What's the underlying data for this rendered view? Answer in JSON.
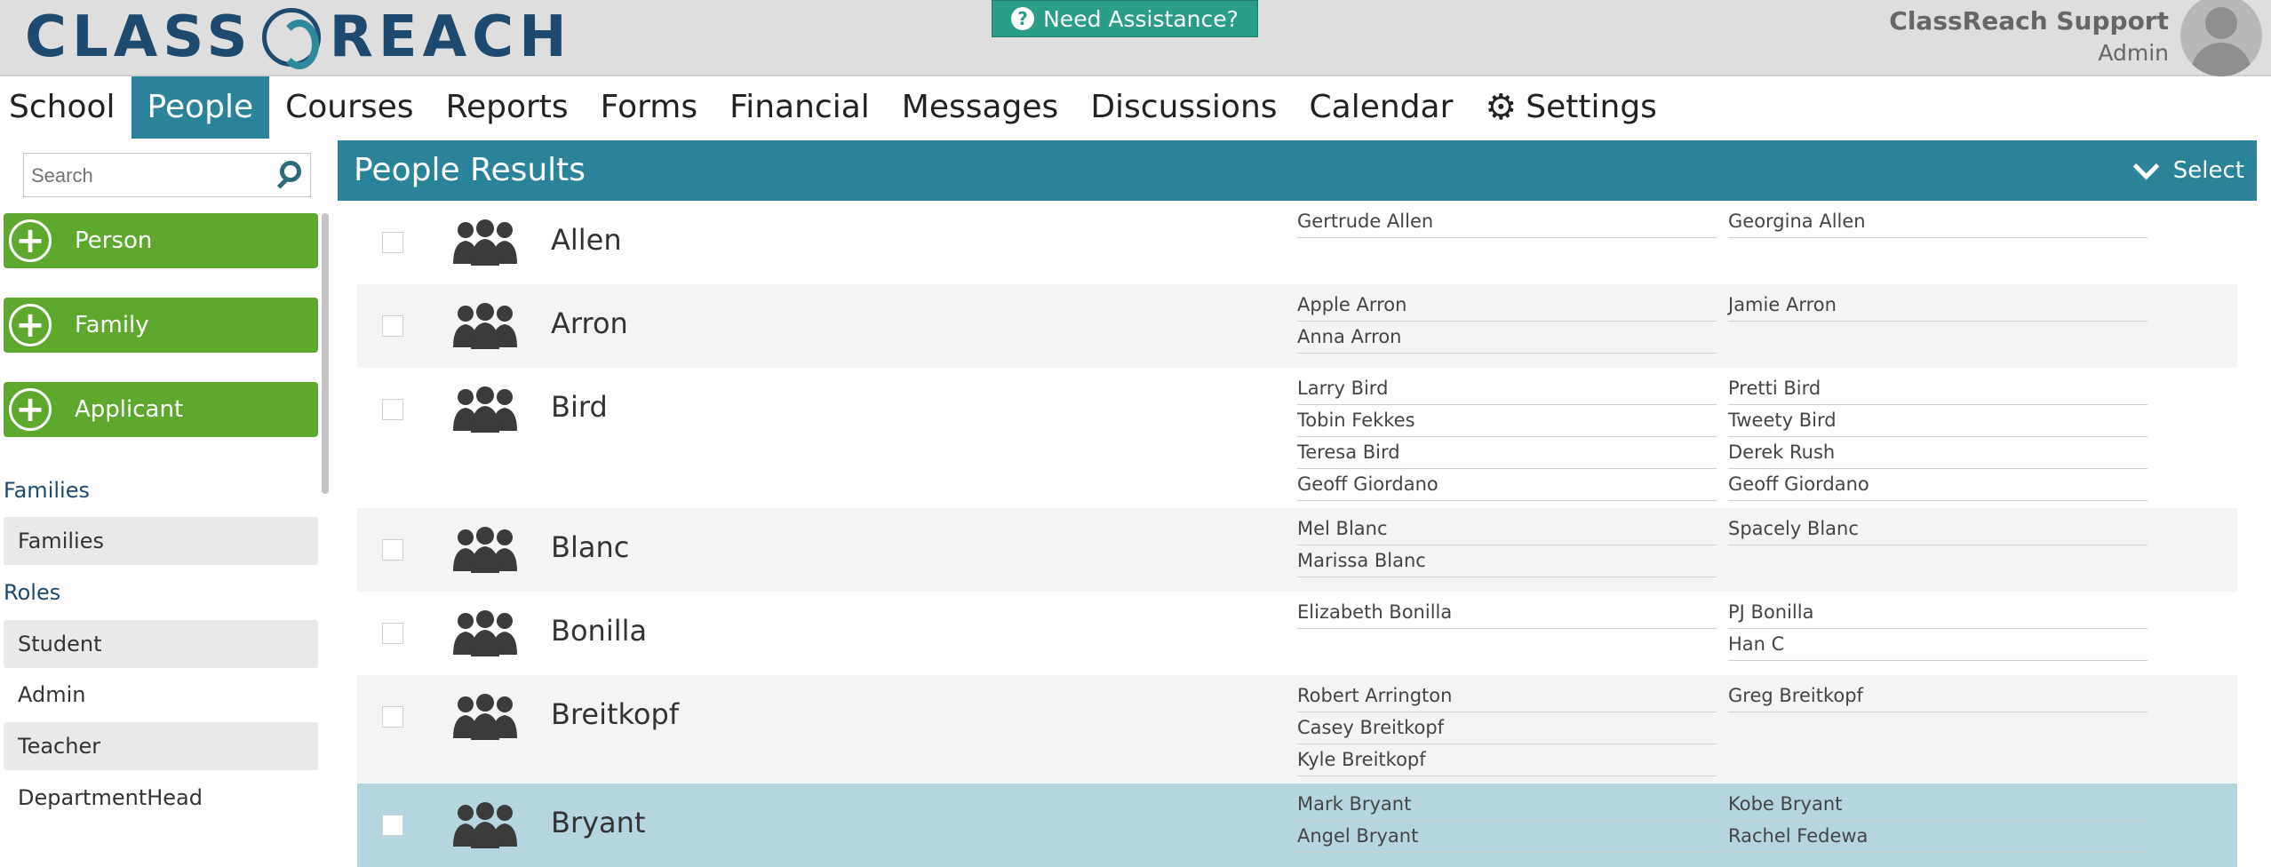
{
  "header": {
    "logo_text_left": "CLASS",
    "logo_text_right": "REACH",
    "help_label": "Need Assistance?",
    "user_name": "ClassReach Support",
    "user_role": "Admin"
  },
  "nav": {
    "items": [
      "School",
      "People",
      "Courses",
      "Reports",
      "Forms",
      "Financial",
      "Messages",
      "Discussions",
      "Calendar",
      "Settings"
    ],
    "active": "People"
  },
  "sidebar": {
    "search_placeholder": "Search",
    "add_buttons": [
      "Person",
      "Family",
      "Applicant"
    ],
    "families_heading": "Families",
    "families_links": [
      "Families"
    ],
    "roles_heading": "Roles",
    "roles_links": [
      "Student",
      "Admin",
      "Teacher",
      "DepartmentHead"
    ]
  },
  "main": {
    "title": "People Results",
    "select_label": "Select"
  },
  "families": [
    {
      "name": "Allen",
      "col1": [
        "Gertrude Allen"
      ],
      "col2": [
        "Georgina Allen"
      ]
    },
    {
      "name": "Arron",
      "col1": [
        "Apple Arron",
        "Anna Arron"
      ],
      "col2": [
        "Jamie Arron"
      ]
    },
    {
      "name": "Bird",
      "col1": [
        "Larry Bird",
        "Tobin Fekkes",
        "Teresa Bird",
        "Geoff Giordano"
      ],
      "col2": [
        "Pretti Bird",
        "Tweety Bird",
        "Derek Rush",
        "Geoff Giordano"
      ]
    },
    {
      "name": "Blanc",
      "col1": [
        "Mel Blanc",
        "Marissa Blanc"
      ],
      "col2": [
        "Spacely Blanc"
      ]
    },
    {
      "name": "Bonilla",
      "col1": [
        "Elizabeth Bonilla"
      ],
      "col2": [
        "PJ Bonilla",
        "Han C"
      ]
    },
    {
      "name": "Breitkopf",
      "col1": [
        "Robert Arrington",
        "Casey Breitkopf",
        "Kyle Breitkopf"
      ],
      "col2": [
        "Greg Breitkopf"
      ]
    },
    {
      "name": "Bryant",
      "col1": [
        "Mark Bryant",
        "Angel Bryant"
      ],
      "col2": [
        "Kobe Bryant",
        "Rachel Fedewa"
      ]
    }
  ]
}
